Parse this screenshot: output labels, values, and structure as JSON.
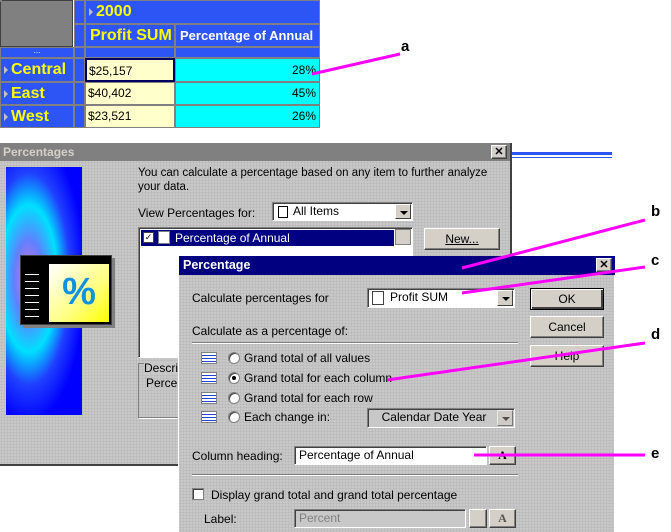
{
  "pivot": {
    "year": "2000",
    "col_headers": [
      "Profit SUM",
      "Percentage of Annual"
    ],
    "ellipsis": "...",
    "rows": [
      {
        "region": "Central",
        "profit": "$25,157",
        "pct": "28%"
      },
      {
        "region": "East",
        "profit": "$40,402",
        "pct": "45%"
      },
      {
        "region": "West",
        "profit": "$23,521",
        "pct": "26%"
      }
    ]
  },
  "percentages_dialog": {
    "title": "Percentages",
    "close": "✕",
    "intro": "You can calculate a percentage based on any item to further analyze your data.",
    "view_label": "View Percentages for:",
    "view_value": "All Items",
    "list_items": [
      "Percentage of Annual"
    ],
    "new_button": "New...",
    "description_label": "Descri",
    "description_text": "Percer"
  },
  "percentage_dialog": {
    "title": "Percentage",
    "close": "✕",
    "calc_for_label": "Calculate percentages for",
    "calc_for_value": "Profit SUM",
    "calc_as_label": "Calculate as a percentage of:",
    "options": [
      {
        "label": "Grand total of all values",
        "selected": false
      },
      {
        "label": "Grand total for each column",
        "selected": true
      },
      {
        "label": "Grand total for each row",
        "selected": false
      },
      {
        "label": "Each change in:",
        "selected": false
      }
    ],
    "each_change_value": "Calendar Date Year",
    "column_heading_label": "Column heading:",
    "column_heading_value": "Percentage of Annual",
    "display_total_label": "Display grand total and grand total percentage",
    "display_total_checked": false,
    "label_label": "Label:",
    "label_value": "Percent",
    "ok": "OK",
    "cancel": "Cancel",
    "help": "Help"
  },
  "callouts": [
    "a",
    "b",
    "c",
    "d",
    "e"
  ],
  "colors": {
    "callout_line": "#ff00ff",
    "pivot_blue": "#2d55f5",
    "title_navy": "#000080",
    "pct_cyan": "#00ffff",
    "profit_cream": "#ffffcc"
  }
}
